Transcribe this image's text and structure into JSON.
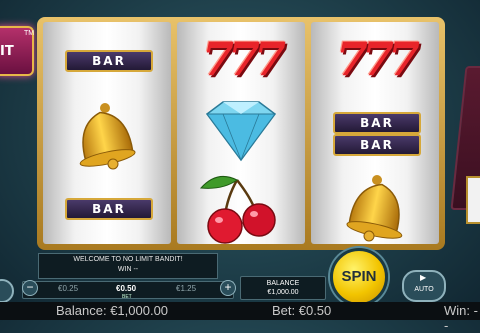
{
  "logo": {
    "text": "IT",
    "tm": "TM"
  },
  "reels": [
    [
      {
        "symbol": "bar",
        "label": "BAR"
      },
      {
        "symbol": "bell"
      },
      {
        "symbol": "bar",
        "label": "BAR"
      }
    ],
    [
      {
        "symbol": "seven",
        "label": "777"
      },
      {
        "symbol": "diamond"
      },
      {
        "symbol": "cherries"
      }
    ],
    [
      {
        "symbol": "seven",
        "label": "777"
      },
      {
        "symbol": "double-bar",
        "label": "BAR"
      },
      {
        "symbol": "bell"
      }
    ]
  ],
  "message": {
    "line1": "WELCOME TO NO LIMIT BANDIT!",
    "line2": "WIN --"
  },
  "bet": {
    "minus": "−",
    "plus": "+",
    "options": [
      "€0.25",
      "€0.50",
      "€1.25"
    ],
    "label": "BET"
  },
  "balance": {
    "label": "BALANCE",
    "amount": "€1,000.00"
  },
  "spin": {
    "label": "SPIN"
  },
  "auto": {
    "icon": "▶",
    "label": "AUTO"
  },
  "status": {
    "balance": "Balance: €1,000.00",
    "bet": "Bet: €0.50",
    "win": "Win: --"
  },
  "colors": {
    "frame": "#d8a93c",
    "spin": "#f2c400",
    "seven": "#e8242a"
  }
}
